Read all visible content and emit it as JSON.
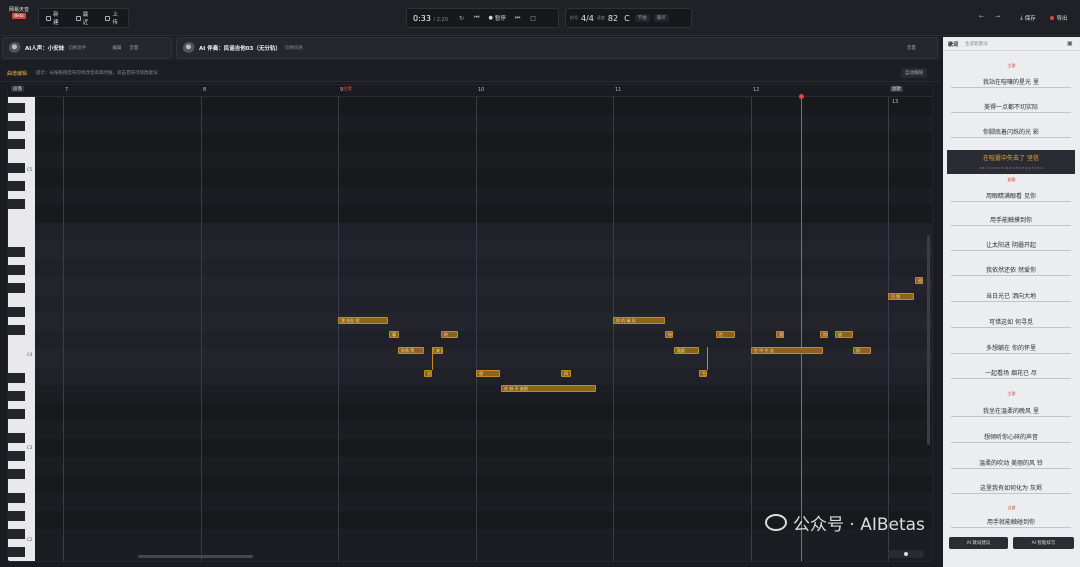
{
  "app": {
    "logo_text": "网易天音",
    "logo_tag": "Beta"
  },
  "toolbar": {
    "new_label": "新建",
    "recent_label": "最近",
    "upload_label": "上传",
    "time": "0:33",
    "duration": "/ 2:20",
    "play_label": "暂停",
    "signature": "4/4",
    "signature_label": "拍号",
    "bpm": "82",
    "bpm_label": "速度",
    "key": "C",
    "metronome_label": "节拍",
    "loop_label": "循环",
    "save_label": "保存",
    "export_label": "导出"
  },
  "tracks": {
    "voice": {
      "name": "AI人声：小安妹",
      "sub": "切换歌手",
      "edit": "编辑",
      "vol": "音量"
    },
    "accomp": {
      "name": "AI 伴奏：民谣吉他03（无分轨）",
      "sub": "切换风格",
      "vol": "音量"
    }
  },
  "editor": {
    "mode_label": "曲谱编辑",
    "hint": "提示：长按拖拽音符可修改音高和时值，双击音符可修改歌词",
    "follow_label": "自动跟随"
  },
  "ruler": {
    "bars": [
      "7",
      "8",
      "9",
      "10",
      "11",
      "12",
      "13"
    ],
    "marker_verse": "主歌",
    "marker_chorus": "副歌",
    "marker_left": "段落"
  },
  "keys": {
    "c5": "C5",
    "c4": "C4",
    "c3": "C3",
    "c2": "C2"
  },
  "notes": [
    {
      "text": "我  站在 喧"
    },
    {
      "text": "嚷"
    },
    {
      "text": "的"
    },
    {
      "text": "街角  等"
    },
    {
      "text": "光"
    },
    {
      "text": "来  回"
    },
    {
      "text": "想"
    },
    {
      "text": "  在   林   不  安稳"
    },
    {
      "text": "你   的 精 彩"
    },
    {
      "text": "间"
    },
    {
      "text": "你"
    },
    {
      "text": "在"
    },
    {
      "text": "鼓励"
    },
    {
      "text": "生"
    },
    {
      "text": "在   中  光  去"
    },
    {
      "text": "我"
    },
    {
      "text": "你"
    },
    {
      "text": "放"
    },
    {
      "text": "阳"
    },
    {
      "text": "归  期"
    },
    {
      "text": "给"
    }
  ],
  "lyrics": {
    "title": "歌词",
    "subtitle": "生成新歌词",
    "section_verse": "主歌",
    "section_chorus": "副歌",
    "section_bridge": "过渡",
    "lines_a": [
      "我站在喧嚷的星光    里",
      "美得一点都不切实际",
      "你脚底着闪烁的光    影"
    ],
    "active_line": "在喧嚣中失去了    坚信",
    "pinyin": "z a i x u a n x i a o z h o n g s h i q u",
    "lines_b": [
      "用眼睛满眼看    见你",
      "用手能触摸到你",
      "让太阳进    阴霾开起",
      "我依然还依    然爱你",
      "当日光已    洒向大地",
      "可惜这如    何寻觅",
      "多想躺在    你的怀里",
      "一起看场    烟花已    尽"
    ],
    "lines_c": [
      "我坐在温柔的晚风    里",
      "想倾听你心碎的声音",
      "温柔的吹动    美丽的风    铃",
      "这里我有如何化为    灰烬"
    ],
    "line_d": "用手就能触碰到你",
    "btn_left": "AI 歌词建议",
    "btn_right": "AI 智能续写"
  },
  "watermark": "公众号 · AIBetas"
}
